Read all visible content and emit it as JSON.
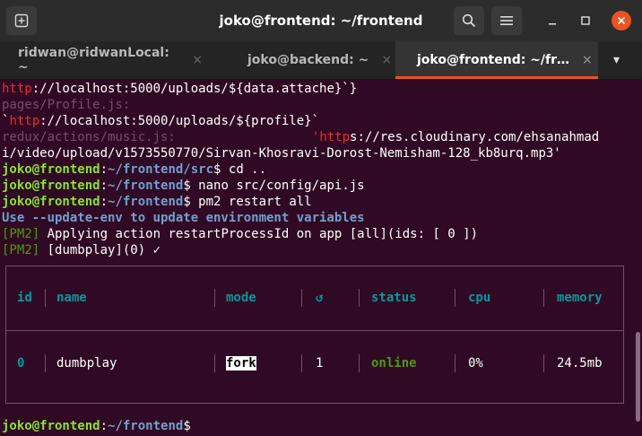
{
  "window": {
    "title": "joko@frontend: ~/frontend",
    "icons": {
      "new_tab": "new-tab-icon",
      "search": "search-icon",
      "menu": "hamburger-icon",
      "minimize": "minimize-icon",
      "maximize": "maximize-icon",
      "close": "close-icon"
    }
  },
  "tabs": [
    {
      "label": "ridwan@ridwanLocal: ~",
      "close": "×"
    },
    {
      "label": "joko@backend: ~",
      "close": "×"
    },
    {
      "label": "joko@frontend: ~/fr…",
      "close": "×"
    }
  ],
  "tabs_dropdown": "▾",
  "terminal": {
    "l1": {
      "a": "http",
      "b": "://localhost:5000/uploads/${data.attache}`}"
    },
    "l2": {
      "a": "pages/Profile.js:"
    },
    "l3": {
      "a": "`",
      "b": "http",
      "c": "://localhost:5000/uploads/${profile}`"
    },
    "l4": {
      "a": "redux/actions/music.js:",
      "b": "'http",
      "c": "s://res.cloudinary.com/ehsanahmad"
    },
    "l5": {
      "a": "i/video/upload/v1573550770/Sirvan-Khosravi-Dorost-Nemisham-128_kb8urq.mp3'"
    },
    "l6": {
      "user": "joko@frontend",
      "sep": ":",
      "path": "~/frontend/src",
      "cmd": "$ cd .."
    },
    "l7": {
      "user": "joko@frontend",
      "sep": ":",
      "path": "~/frontend",
      "cmd": "$ nano src/config/api.js"
    },
    "l8": {
      "user": "joko@frontend",
      "sep": ":",
      "path": "~/frontend",
      "cmd": "$ pm2 restart all"
    },
    "l9": {
      "a": "Use --update-env to update environment variables"
    },
    "l10": {
      "tag": "[PM2]",
      "text": " Applying action restartProcessId on app [all](ids: [ 0 ])"
    },
    "l11": {
      "tag": "[PM2]",
      "text": " [dumbplay](0) ✓"
    },
    "prompt": {
      "user": "joko@frontend",
      "sep": ":",
      "path": "~/frontend",
      "cmd": "$"
    }
  },
  "pm2_table": {
    "headers": {
      "id": "id",
      "name": "name",
      "mode": "mode",
      "restarts": "↺",
      "status": "status",
      "cpu": "cpu",
      "memory": "memory"
    },
    "row": {
      "id": "0",
      "name": "dumbplay",
      "mode": "fork",
      "restarts": "1",
      "status": "online",
      "cpu": "0%",
      "memory": "24.5mb"
    }
  }
}
